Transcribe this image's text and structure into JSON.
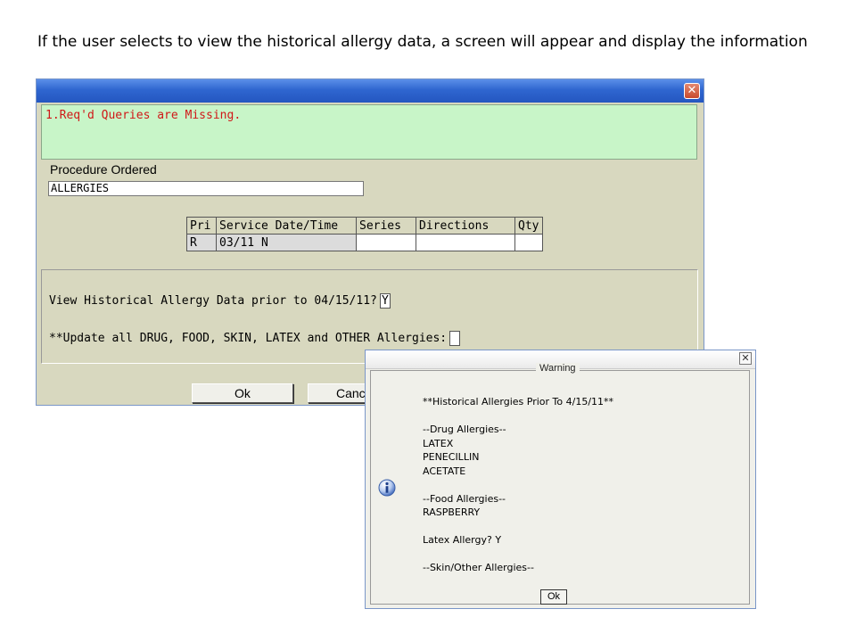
{
  "caption": "If the user selects to view the historical allergy data, a screen will appear and display the information",
  "main_window": {
    "close_glyph": "✕",
    "error_message": "1.Req'd Queries are Missing.",
    "procedure_label": "Procedure Ordered",
    "procedure_value": "ALLERGIES",
    "table": {
      "headers": [
        "Pri",
        "Service Date/Time",
        "Series",
        "Directions",
        "Qty"
      ],
      "row": [
        "R",
        "03/11 N",
        "",
        "",
        ""
      ]
    },
    "question_history": "View Historical Allergy Data prior to 04/15/11?",
    "question_history_answer": "Y",
    "question_update": "**Update all DRUG, FOOD, SKIN, LATEX and OTHER Allergies:",
    "question_update_answer": "",
    "ok_label": "Ok",
    "cancel_label": "Cance"
  },
  "warning_dialog": {
    "close_glyph": "✕",
    "title": "Warning",
    "icon": "info-icon",
    "lines": [
      "**Historical Allergies Prior To 4/15/11**",
      "",
      "--Drug Allergies--",
      "LATEX",
      "PENECILLIN",
      "ACETATE",
      "",
      "--Food Allergies--",
      "RASPBERRY",
      "",
      "Latex Allergy? Y",
      "",
      "--Skin/Other Allergies--"
    ],
    "ok_label": "Ok"
  },
  "colors": {
    "titlebar_blue": "#2f66d0",
    "window_bg": "#d8d8bf",
    "error_bg": "#c8f5c8",
    "error_text": "#d01818"
  }
}
